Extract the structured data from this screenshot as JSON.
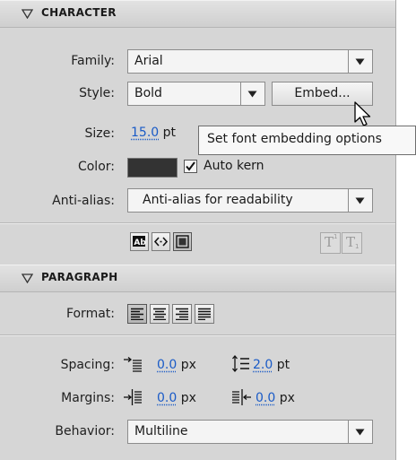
{
  "character": {
    "title": "CHARACTER",
    "family_label": "Family:",
    "family_value": "Arial",
    "style_label": "Style:",
    "style_value": "Bold",
    "embed_button": "Embed...",
    "size_label": "Size:",
    "size_value": "15.0",
    "size_unit": "pt",
    "tooltip": "Set font embedding options",
    "color_label": "Color:",
    "color_value": "#333333",
    "auto_kern_label": "Auto kern",
    "auto_kern_checked": true,
    "anti_alias_label": "Anti-alias:",
    "anti_alias_value": "Anti-alias for readability",
    "format_icons": [
      "selectable-icon",
      "render-html-icon",
      "show-border-icon"
    ],
    "script_icons": [
      "superscript-icon",
      "subscript-icon"
    ],
    "superscript_glyph": "T",
    "subscript_glyph": "T"
  },
  "paragraph": {
    "title": "PARAGRAPH",
    "format_label": "Format:",
    "align_buttons": [
      "align-left-icon",
      "align-center-icon",
      "align-right-icon",
      "justify-icon"
    ],
    "spacing_label": "Spacing:",
    "indent_value": "0.0",
    "indent_unit": "px",
    "line_spacing_value": "2.0",
    "line_spacing_unit": "pt",
    "margins_label": "Margins:",
    "left_margin_value": "0.0",
    "left_margin_unit": "px",
    "right_margin_value": "0.0",
    "right_margin_unit": "px",
    "behavior_label": "Behavior:",
    "behavior_value": "Multiline"
  }
}
